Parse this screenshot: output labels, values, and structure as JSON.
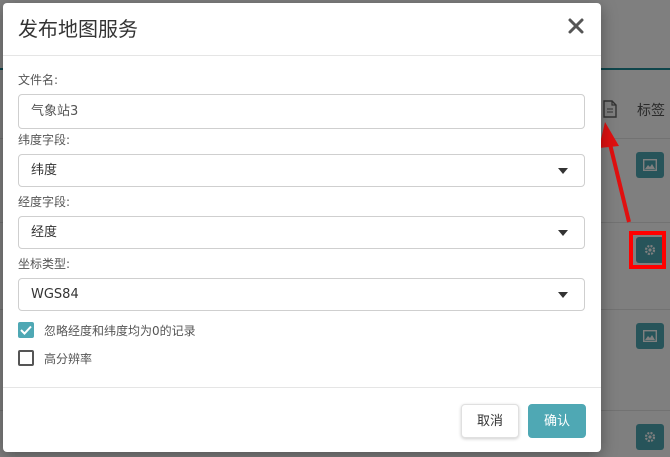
{
  "background": {
    "column_header_label": "标签",
    "doc_icon": "document-icon",
    "row_buttons": [
      {
        "icon": "image-icon"
      },
      {
        "icon": "gear-icon"
      },
      {
        "icon": "image-icon"
      },
      {
        "icon": "gear-icon"
      }
    ]
  },
  "modal": {
    "title": "发布地图服务",
    "close_icon": "close-icon",
    "file_name": {
      "label": "文件名:",
      "value": "气象站3"
    },
    "lat_field": {
      "label": "纬度字段:",
      "value": "纬度"
    },
    "lng_field": {
      "label": "经度字段:",
      "value": "经度"
    },
    "coord_type": {
      "label": "坐标类型:",
      "value": "WGS84"
    },
    "options": [
      {
        "label": "忽略经度和纬度均为0的记录",
        "checked": true
      },
      {
        "label": "高分辨率",
        "checked": false
      }
    ],
    "cancel_label": "取消",
    "ok_label": "确认"
  },
  "colors": {
    "accent": "#4fa8b4",
    "highlight": "#ff0000"
  }
}
